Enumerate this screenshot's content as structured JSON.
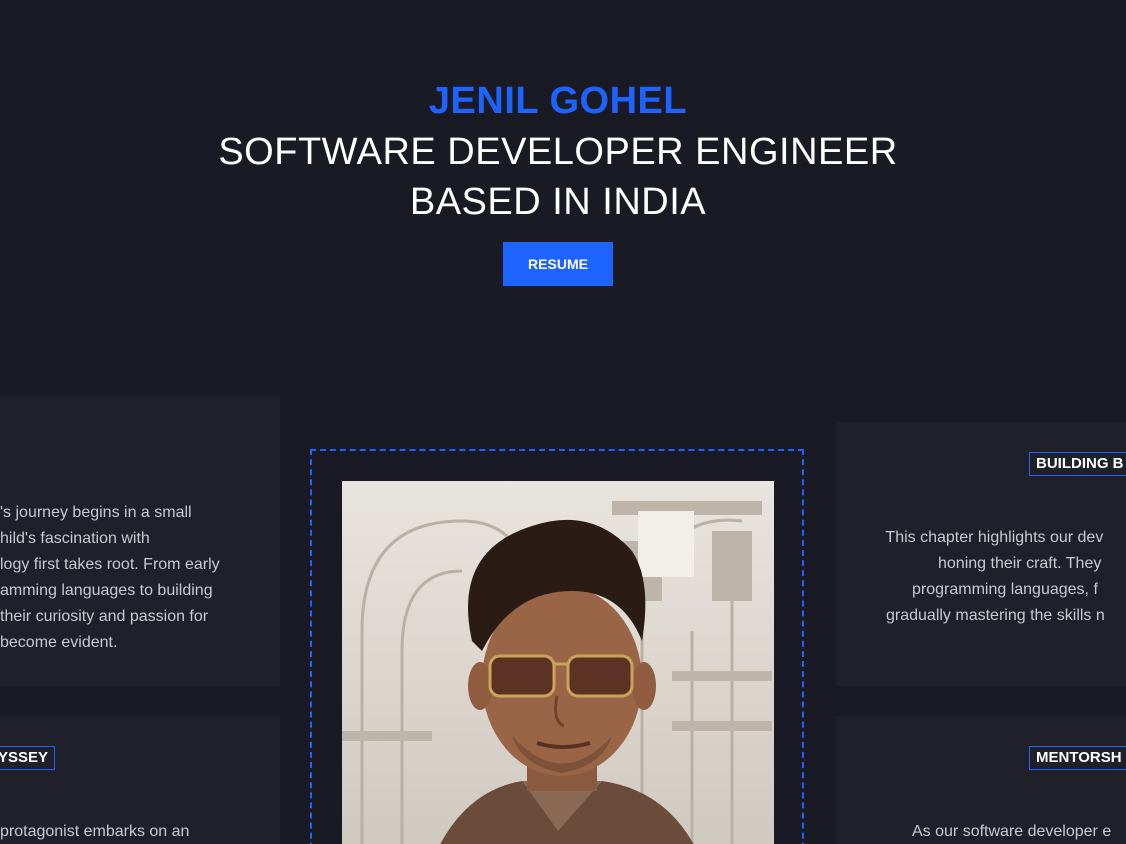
{
  "hero": {
    "name": "JENIL GOHEL",
    "line1": "SOFTWARE DEVELOPER ENGINEER",
    "line2": "BASED IN INDIA",
    "resume_label": "RESUME"
  },
  "cards": {
    "left_top": {
      "lines": [
        "'s journey begins in a small",
        "hild's fascination with",
        "logy first takes root. From early",
        "amming languages to building",
        "their curiosity and passion for",
        "become evident."
      ]
    },
    "left_bottom": {
      "tag": "YSSEY",
      "lines": [
        "protagonist embarks on an"
      ]
    },
    "right_top": {
      "tag": "BUILDING B",
      "lines": [
        "This chapter highlights our dev",
        "honing their craft. They",
        "programming languages, f",
        "gradually mastering the skills n"
      ]
    },
    "right_bottom": {
      "tag": "MENTORSH",
      "lines": [
        "As our software developer e"
      ]
    }
  },
  "colors": {
    "background": "#191a23",
    "card": "#1f2029",
    "accent": "#1c63ff"
  }
}
